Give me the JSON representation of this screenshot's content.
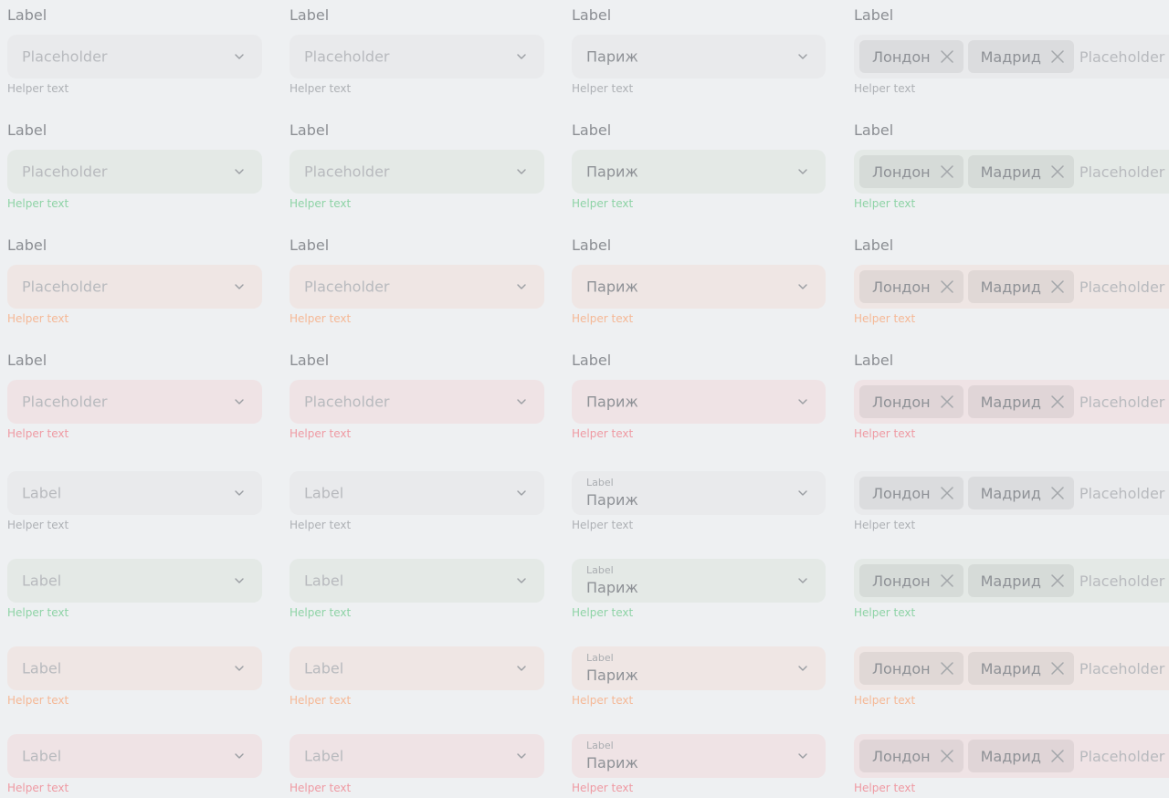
{
  "label": "Label",
  "placeholder": "Placeholder",
  "helper": "Helper text",
  "selected_value": "Париж",
  "chips": [
    "Лондон",
    "Мадрид"
  ],
  "icons": {
    "dropdown": "chevron-down-icon",
    "chip_remove": "close-icon"
  },
  "states": [
    {
      "name": "default",
      "background": "#e9eaec",
      "helper_color": "#aeb1b5"
    },
    {
      "name": "success",
      "background": "#e4e9e6",
      "helper_color": "#8ed3a6"
    },
    {
      "name": "warning",
      "background": "#efe6e4",
      "helper_color": "#f5b896"
    },
    {
      "name": "error",
      "background": "#efe3e5",
      "helper_color": "#ef9aa3"
    }
  ],
  "variants": [
    "placeholder-select",
    "placeholder-select-secondary",
    "selected-value-select",
    "multi-select-chips"
  ],
  "layouts": [
    "outer-label",
    "inner-label"
  ]
}
